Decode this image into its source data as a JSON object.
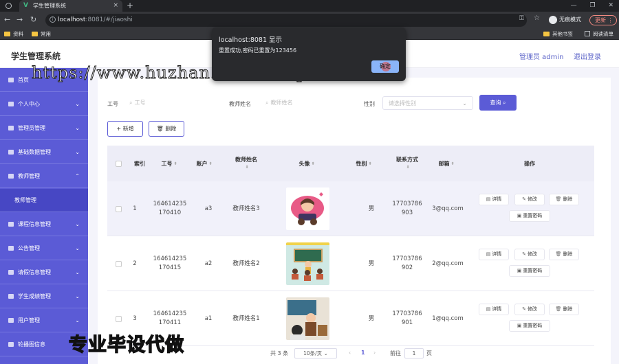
{
  "browser": {
    "tab_title": "学生管理系统",
    "tab_close": "×",
    "new_tab": "+",
    "url_host": "localhost",
    "url_path": ":8081/#/jiaoshi",
    "incognito_label": "无痕模式",
    "update_label": "更新",
    "bookmarks": [
      "资料",
      "常用"
    ],
    "bookmarks_right": [
      "其他书签",
      "阅读清单"
    ],
    "window_controls": [
      "—",
      "❐",
      "✕"
    ]
  },
  "dialog": {
    "title": "localhost:8081 显示",
    "message": "重置成功,密码已重置为123456",
    "ok_label": "确定"
  },
  "header": {
    "app_title": "学生管理系统",
    "admin_label": "管理员 admin",
    "logout_label": "退出登录"
  },
  "sidebar": {
    "items": [
      {
        "label": "首页",
        "arrow": ""
      },
      {
        "label": "个人中心",
        "arrow": "⌄"
      },
      {
        "label": "管理员管理",
        "arrow": "⌄"
      },
      {
        "label": "基础数据管理",
        "arrow": "⌄"
      },
      {
        "label": "教师管理",
        "arrow": "⌃"
      },
      {
        "label": "课程信息管理",
        "arrow": "⌄"
      },
      {
        "label": "公告管理",
        "arrow": "⌄"
      },
      {
        "label": "请假信息管理",
        "arrow": "⌄"
      },
      {
        "label": "学生成绩管理",
        "arrow": "⌄"
      },
      {
        "label": "用户管理",
        "arrow": "⌄"
      },
      {
        "label": "轮播图信息",
        "arrow": "⌄"
      }
    ],
    "sub_item": "教师管理"
  },
  "search": {
    "gonghao_label": "工号",
    "gonghao_placeholder": "工号",
    "name_label": "教师姓名",
    "name_placeholder": "教师姓名",
    "sex_label": "性别",
    "sex_placeholder": "请选择性别",
    "query_label": "查询"
  },
  "toolbar": {
    "add_label": "+ 新增",
    "delete_label": "删除"
  },
  "table": {
    "headers": {
      "index": "索引",
      "gonghao": "工号",
      "account": "账户",
      "name": "教师姓名",
      "avatar": "头像",
      "sex": "性别",
      "phone": "联系方式",
      "email": "邮箱",
      "actions": "操作"
    },
    "rows": [
      {
        "index": "1",
        "gonghao": "164614235170410",
        "account": "a3",
        "name": "教师姓名3",
        "sex": "男",
        "phone": "17703786903",
        "email": "3@qq.com"
      },
      {
        "index": "2",
        "gonghao": "164614235170415",
        "account": "a2",
        "name": "教师姓名2",
        "sex": "男",
        "phone": "17703786902",
        "email": "2@qq.com"
      },
      {
        "index": "3",
        "gonghao": "164614235170411",
        "account": "a1",
        "name": "教师姓名1",
        "sex": "男",
        "phone": "17703786901",
        "email": "1@qq.com"
      }
    ],
    "action_labels": {
      "detail": "详情",
      "edit": "修改",
      "delete": "删除",
      "reset": "重置密码"
    }
  },
  "pagination": {
    "total": "共 3 条",
    "page_size": "10条/页",
    "current_page": "1",
    "goto_label": "前往",
    "goto_value": "1",
    "page_unit": "页"
  },
  "watermark": {
    "url": "https://www.huzhan.com/ishop39397",
    "text": "专业毕设代做"
  },
  "colors": {
    "accent": "#5b5bd6",
    "sidebar": "#5b5bd6"
  }
}
